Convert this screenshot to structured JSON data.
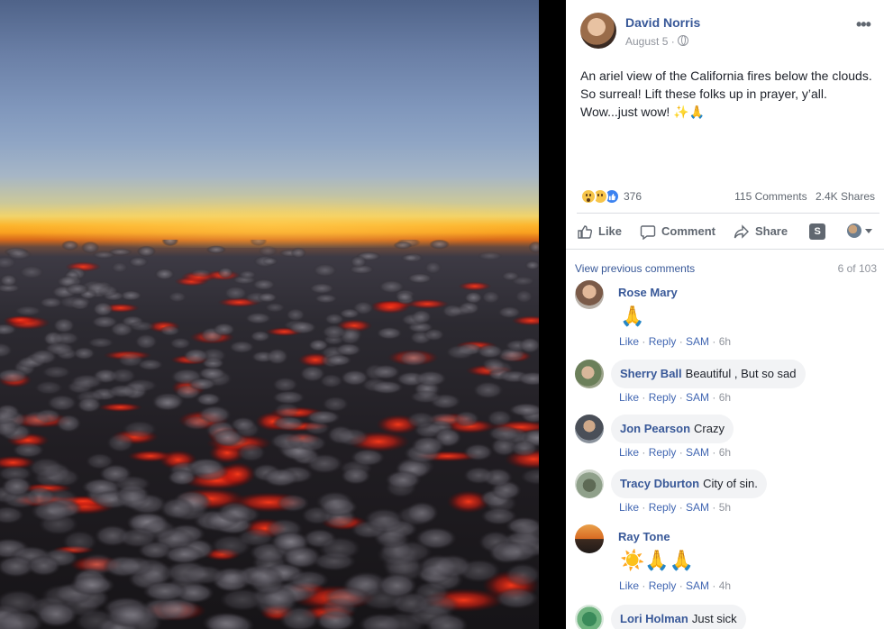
{
  "post": {
    "author": "David Norris",
    "date": "August 5 ·",
    "more": "•••",
    "text_lines": [
      "An ariel view of the California fires below the clouds.",
      "So surreal! Lift these folks up in prayer, y’all.",
      "Wow...just wow!"
    ],
    "text_emojis": "✨🙏",
    "reaction_count": "376",
    "comments_count": "115 Comments",
    "shares_count": "2.4K Shares"
  },
  "actions": {
    "like": "Like",
    "comment": "Comment",
    "share": "Share",
    "s_badge": "S"
  },
  "comments_header": {
    "view_previous": "View previous comments",
    "pager": "6 of 103"
  },
  "comments": [
    {
      "name": "Rose Mary",
      "text": "",
      "emoji": "🙏",
      "meta_like": "Like",
      "meta_reply": "Reply",
      "meta_sam": "SAM",
      "time": "6h"
    },
    {
      "name": "Sherry Ball",
      "text": "Beautiful , But so sad",
      "meta_like": "Like",
      "meta_reply": "Reply",
      "meta_sam": "SAM",
      "time": "6h"
    },
    {
      "name": "Jon Pearson",
      "text": "Crazy",
      "meta_like": "Like",
      "meta_reply": "Reply",
      "meta_sam": "SAM",
      "time": "6h"
    },
    {
      "name": "Tracy Dburton",
      "text": "City of sin.",
      "meta_like": "Like",
      "meta_reply": "Reply",
      "meta_sam": "SAM",
      "time": "5h"
    },
    {
      "name": "Ray Tone",
      "text": "",
      "emoji": "☀️🙏🙏",
      "meta_like": "Like",
      "meta_reply": "Reply",
      "meta_sam": "SAM",
      "time": "4h"
    },
    {
      "name": "Lori Holman",
      "text": "Just sick"
    }
  ],
  "colors": {
    "link_blue": "#385898",
    "meta_gray": "#90949c",
    "bubble_bg": "#f2f3f5"
  }
}
